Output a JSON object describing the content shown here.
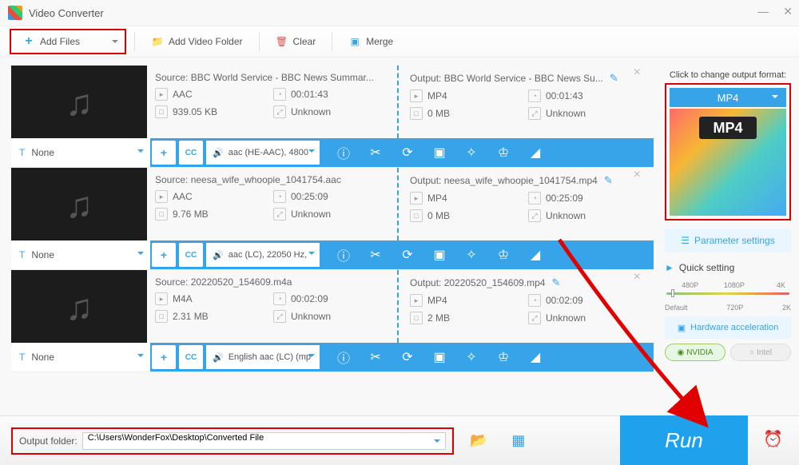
{
  "app": {
    "title": "Video Converter"
  },
  "toolbar": {
    "add_files": "Add Files",
    "add_folder": "Add Video Folder",
    "clear": "Clear",
    "merge": "Merge"
  },
  "items": [
    {
      "source_label": "Source: BBC World Service - BBC News Summar...",
      "codec": "AAC",
      "duration": "00:01:43",
      "size": "939.05 KB",
      "dim": "Unknown",
      "out_label": "Output: BBC World Service - BBC News Su...",
      "out_codec": "MP4",
      "out_duration": "00:01:43",
      "out_size": "0 MB",
      "out_dim": "Unknown",
      "title": "None",
      "audio_sel": "aac (HE-AAC), 4800"
    },
    {
      "source_label": "Source: neesa_wife_whoopie_1041754.aac",
      "codec": "AAC",
      "duration": "00:25:09",
      "size": "9.76 MB",
      "dim": "Unknown",
      "out_label": "Output: neesa_wife_whoopie_1041754.mp4",
      "out_codec": "MP4",
      "out_duration": "00:25:09",
      "out_size": "0 MB",
      "out_dim": "Unknown",
      "title": "None",
      "audio_sel": "aac (LC), 22050 Hz,"
    },
    {
      "source_label": "Source: 20220520_154609.m4a",
      "codec": "M4A",
      "duration": "00:02:09",
      "size": "2.31 MB",
      "dim": "Unknown",
      "out_label": "Output: 20220520_154609.mp4",
      "out_codec": "MP4",
      "out_duration": "00:02:09",
      "out_size": "2 MB",
      "out_dim": "Unknown",
      "title": "None",
      "audio_sel": "English aac (LC) (mp"
    }
  ],
  "right": {
    "hint": "Click to change output format:",
    "format": "MP4",
    "badge": "MP4",
    "param": "Parameter settings",
    "quick": "Quick setting",
    "ticks_top": [
      "480P",
      "1080P",
      "4K"
    ],
    "ticks_bottom": [
      "Default",
      "720P",
      "2K"
    ],
    "hw": "Hardware acceleration",
    "nvidia": "NVIDIA",
    "intel": "Intel"
  },
  "bottom": {
    "label": "Output folder:",
    "path": "C:\\Users\\WonderFox\\Desktop\\Converted File",
    "run": "Run"
  }
}
